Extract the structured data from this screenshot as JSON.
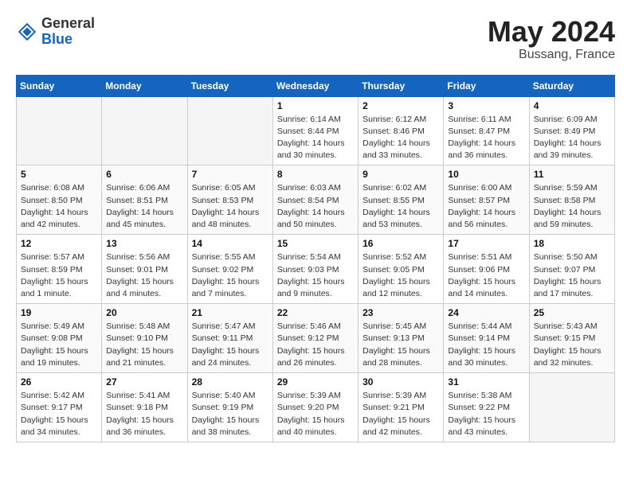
{
  "header": {
    "logo_general": "General",
    "logo_blue": "Blue",
    "month": "May 2024",
    "location": "Bussang, France"
  },
  "columns": [
    "Sunday",
    "Monday",
    "Tuesday",
    "Wednesday",
    "Thursday",
    "Friday",
    "Saturday"
  ],
  "weeks": [
    [
      {
        "day": "",
        "info": ""
      },
      {
        "day": "",
        "info": ""
      },
      {
        "day": "",
        "info": ""
      },
      {
        "day": "1",
        "info": "Sunrise: 6:14 AM\nSunset: 8:44 PM\nDaylight: 14 hours\nand 30 minutes."
      },
      {
        "day": "2",
        "info": "Sunrise: 6:12 AM\nSunset: 8:46 PM\nDaylight: 14 hours\nand 33 minutes."
      },
      {
        "day": "3",
        "info": "Sunrise: 6:11 AM\nSunset: 8:47 PM\nDaylight: 14 hours\nand 36 minutes."
      },
      {
        "day": "4",
        "info": "Sunrise: 6:09 AM\nSunset: 8:49 PM\nDaylight: 14 hours\nand 39 minutes."
      }
    ],
    [
      {
        "day": "5",
        "info": "Sunrise: 6:08 AM\nSunset: 8:50 PM\nDaylight: 14 hours\nand 42 minutes."
      },
      {
        "day": "6",
        "info": "Sunrise: 6:06 AM\nSunset: 8:51 PM\nDaylight: 14 hours\nand 45 minutes."
      },
      {
        "day": "7",
        "info": "Sunrise: 6:05 AM\nSunset: 8:53 PM\nDaylight: 14 hours\nand 48 minutes."
      },
      {
        "day": "8",
        "info": "Sunrise: 6:03 AM\nSunset: 8:54 PM\nDaylight: 14 hours\nand 50 minutes."
      },
      {
        "day": "9",
        "info": "Sunrise: 6:02 AM\nSunset: 8:55 PM\nDaylight: 14 hours\nand 53 minutes."
      },
      {
        "day": "10",
        "info": "Sunrise: 6:00 AM\nSunset: 8:57 PM\nDaylight: 14 hours\nand 56 minutes."
      },
      {
        "day": "11",
        "info": "Sunrise: 5:59 AM\nSunset: 8:58 PM\nDaylight: 14 hours\nand 59 minutes."
      }
    ],
    [
      {
        "day": "12",
        "info": "Sunrise: 5:57 AM\nSunset: 8:59 PM\nDaylight: 15 hours\nand 1 minute."
      },
      {
        "day": "13",
        "info": "Sunrise: 5:56 AM\nSunset: 9:01 PM\nDaylight: 15 hours\nand 4 minutes."
      },
      {
        "day": "14",
        "info": "Sunrise: 5:55 AM\nSunset: 9:02 PM\nDaylight: 15 hours\nand 7 minutes."
      },
      {
        "day": "15",
        "info": "Sunrise: 5:54 AM\nSunset: 9:03 PM\nDaylight: 15 hours\nand 9 minutes."
      },
      {
        "day": "16",
        "info": "Sunrise: 5:52 AM\nSunset: 9:05 PM\nDaylight: 15 hours\nand 12 minutes."
      },
      {
        "day": "17",
        "info": "Sunrise: 5:51 AM\nSunset: 9:06 PM\nDaylight: 15 hours\nand 14 minutes."
      },
      {
        "day": "18",
        "info": "Sunrise: 5:50 AM\nSunset: 9:07 PM\nDaylight: 15 hours\nand 17 minutes."
      }
    ],
    [
      {
        "day": "19",
        "info": "Sunrise: 5:49 AM\nSunset: 9:08 PM\nDaylight: 15 hours\nand 19 minutes."
      },
      {
        "day": "20",
        "info": "Sunrise: 5:48 AM\nSunset: 9:10 PM\nDaylight: 15 hours\nand 21 minutes."
      },
      {
        "day": "21",
        "info": "Sunrise: 5:47 AM\nSunset: 9:11 PM\nDaylight: 15 hours\nand 24 minutes."
      },
      {
        "day": "22",
        "info": "Sunrise: 5:46 AM\nSunset: 9:12 PM\nDaylight: 15 hours\nand 26 minutes."
      },
      {
        "day": "23",
        "info": "Sunrise: 5:45 AM\nSunset: 9:13 PM\nDaylight: 15 hours\nand 28 minutes."
      },
      {
        "day": "24",
        "info": "Sunrise: 5:44 AM\nSunset: 9:14 PM\nDaylight: 15 hours\nand 30 minutes."
      },
      {
        "day": "25",
        "info": "Sunrise: 5:43 AM\nSunset: 9:15 PM\nDaylight: 15 hours\nand 32 minutes."
      }
    ],
    [
      {
        "day": "26",
        "info": "Sunrise: 5:42 AM\nSunset: 9:17 PM\nDaylight: 15 hours\nand 34 minutes."
      },
      {
        "day": "27",
        "info": "Sunrise: 5:41 AM\nSunset: 9:18 PM\nDaylight: 15 hours\nand 36 minutes."
      },
      {
        "day": "28",
        "info": "Sunrise: 5:40 AM\nSunset: 9:19 PM\nDaylight: 15 hours\nand 38 minutes."
      },
      {
        "day": "29",
        "info": "Sunrise: 5:39 AM\nSunset: 9:20 PM\nDaylight: 15 hours\nand 40 minutes."
      },
      {
        "day": "30",
        "info": "Sunrise: 5:39 AM\nSunset: 9:21 PM\nDaylight: 15 hours\nand 42 minutes."
      },
      {
        "day": "31",
        "info": "Sunrise: 5:38 AM\nSunset: 9:22 PM\nDaylight: 15 hours\nand 43 minutes."
      },
      {
        "day": "",
        "info": ""
      }
    ]
  ]
}
